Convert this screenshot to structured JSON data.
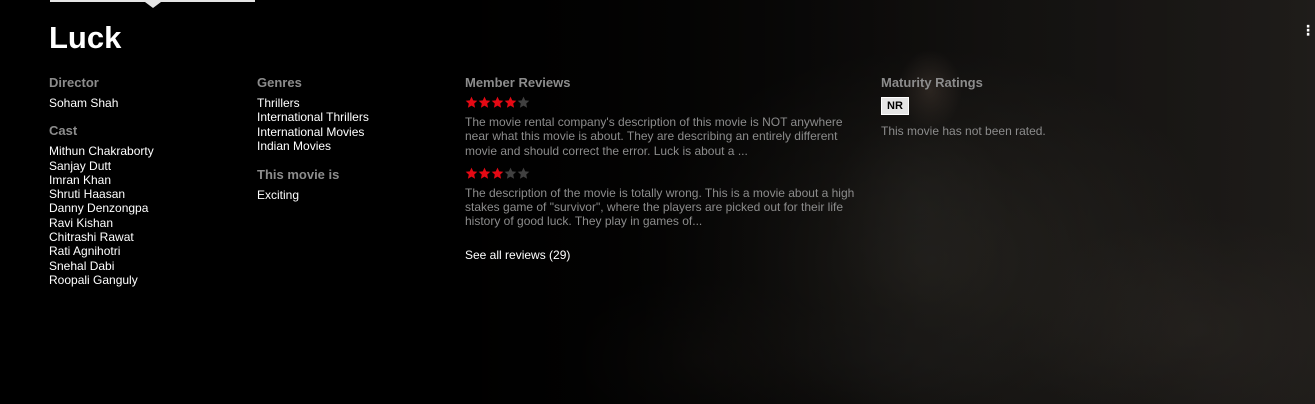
{
  "title": "Luck",
  "director": {
    "label": "Director",
    "names": [
      "Soham Shah"
    ]
  },
  "cast": {
    "label": "Cast",
    "names": [
      "Mithun Chakraborty",
      "Sanjay Dutt",
      "Imran Khan",
      "Shruti Haasan",
      "Danny Denzongpa",
      "Ravi Kishan",
      "Chitrashi Rawat",
      "Rati Agnihotri",
      "Snehal Dabi",
      "Roopali Ganguly"
    ]
  },
  "genres": {
    "label": "Genres",
    "items": [
      "Thrillers",
      "International Thrillers",
      "International Movies",
      "Indian Movies"
    ]
  },
  "this_movie_is": {
    "label": "This movie is",
    "items": [
      "Exciting"
    ]
  },
  "reviews": {
    "label": "Member Reviews",
    "items": [
      {
        "rating": 4,
        "text": "The movie rental company's description of this movie is NOT anywhere near what this movie is about. They are describing an entirely different movie and should correct the error. Luck is about a ..."
      },
      {
        "rating": 3,
        "text": "The description of the movie is totally wrong. This is a movie about a high stakes game of \"survivor\", where the players are picked out for their life history of good luck. They play in games of..."
      }
    ],
    "see_all": "See all reviews (29)"
  },
  "maturity": {
    "label": "Maturity Ratings",
    "badge": "NR",
    "description": "This movie has not been rated."
  },
  "edge_glyph": "⋮",
  "colors": {
    "star_filled": "#e50914",
    "star_empty": "#404040",
    "label": "#8c8c8c",
    "badge_bg": "#e5e5e5"
  }
}
